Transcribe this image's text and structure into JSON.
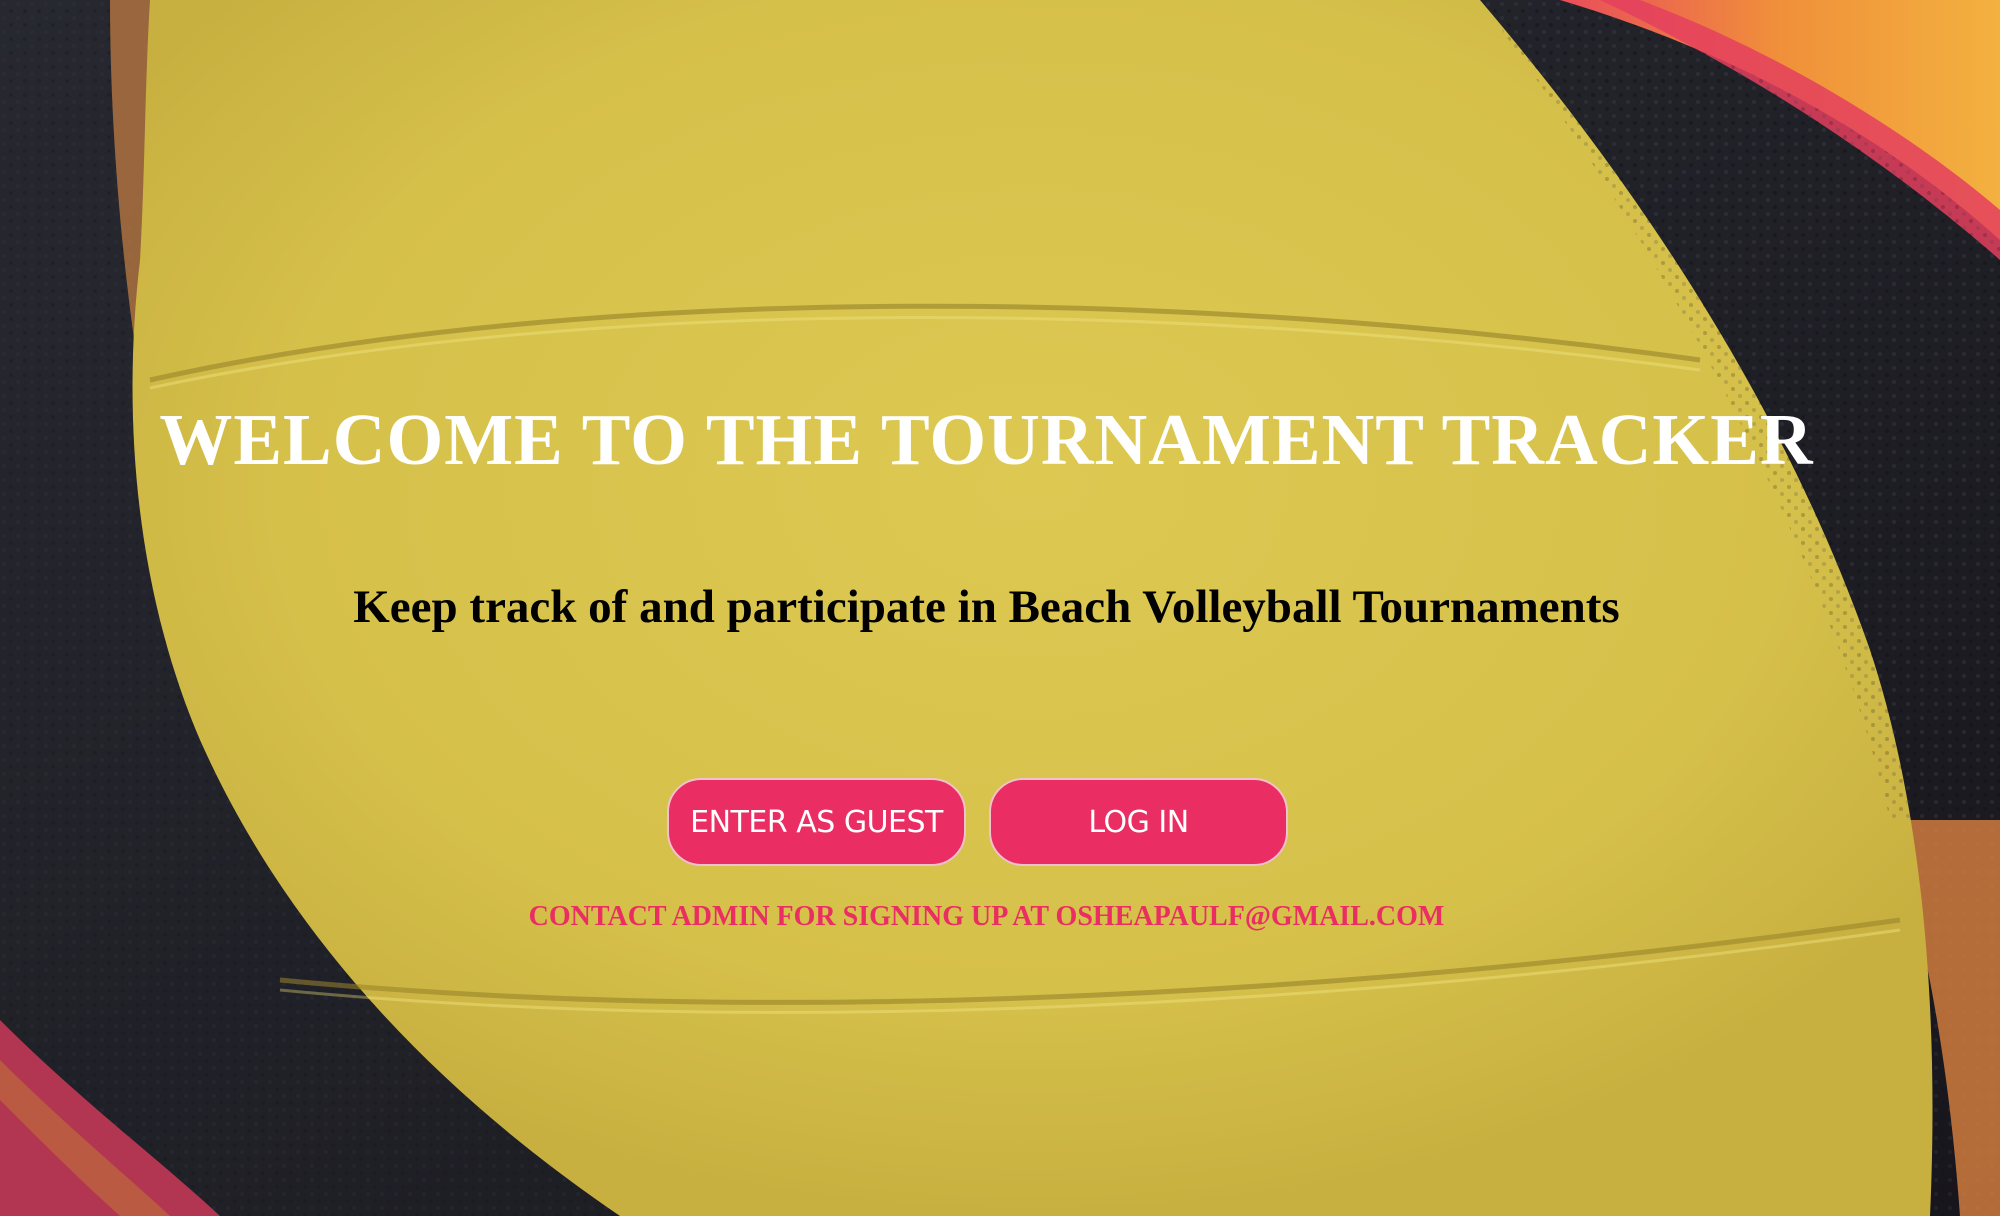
{
  "hero": {
    "title": "WELCOME TO THE TOURNAMENT TRACKER",
    "subtitle": "Keep track of and participate in Beach Volleyball Tournaments"
  },
  "actions": {
    "guest_label": "ENTER AS GUEST",
    "login_label": "LOG IN"
  },
  "footer": {
    "contact_text": "CONTACT ADMIN FOR SIGNING UP AT OSHEAPAULF@GMAIL.COM"
  },
  "colors": {
    "button_bg": "#ea2d62",
    "contact_text": "#ea2d62",
    "ball_yellow": "#d8c449",
    "ball_dark": "#1d1c24"
  }
}
